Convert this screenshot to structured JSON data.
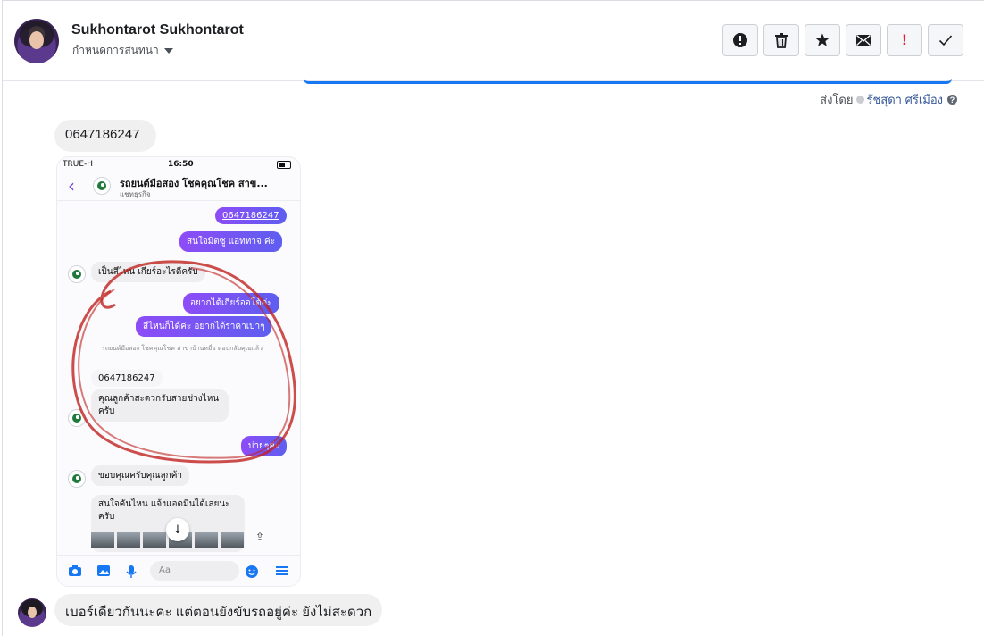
{
  "header": {
    "contact_name": "Sukhontarot Sukhontarot",
    "assign_label": "กำหนดการสนทนา",
    "actions": [
      {
        "name": "report-button",
        "icon": "alert-circle-icon"
      },
      {
        "name": "delete-button",
        "icon": "trash-icon"
      },
      {
        "name": "star-button",
        "icon": "star-icon"
      },
      {
        "name": "mark-unread-button",
        "icon": "envelope-icon"
      },
      {
        "name": "follow-up-button",
        "icon": "exclamation-icon"
      },
      {
        "name": "mark-done-button",
        "icon": "checkmark-icon"
      }
    ]
  },
  "thread": {
    "sent_by_prefix": "ส่งโดย",
    "sent_by_name": "รัชสุดา ศรีเมือง",
    "message_phone": "0647186247",
    "message_last": "เบอร์เดียวกันนะคะ แต่ตอนยังขับรถอยู่ค่ะ ยังไม่สะดวก"
  },
  "phone_screenshot": {
    "carrier": "TRUE-H",
    "time": "16:50",
    "chat_title": "รถยนต์มือสอง โชคคุณโชค สาข...",
    "chat_subtitle": "แชทธุรกิจ",
    "msg_phone": "0647186247",
    "msg_interest": "สนใจมิตซู แอททาจ ค่ะ",
    "msg_color_q": "เป็นสีไหน เกียร์อะไรดีครับ",
    "msg_auto": "อยากได้เกียร์ออโต้ค่ะ",
    "msg_any_color": "สีไหนก็ได้ค่ะ อยากได้ราคาเบาๆ",
    "reply_note": "รถยนต์มือสอง โชคคุณโชค สาขาบ้านหมื่อ ตอบกลับคุณแล้ว",
    "quoted_phone": "0647186247",
    "msg_time_q": "คุณลูกค้าสะดวกรับสายช่วงไหนครับ",
    "msg_evening": "บ่ายๆค่ะ",
    "msg_thanks": "ขอบคุณครับคุณลูกค้า",
    "msg_which_car": "สนใจคันไหน แจ้งแอดมินได้เลยนะครับ",
    "input_placeholder": "Aa",
    "accent_color": "#7d3ff5"
  }
}
